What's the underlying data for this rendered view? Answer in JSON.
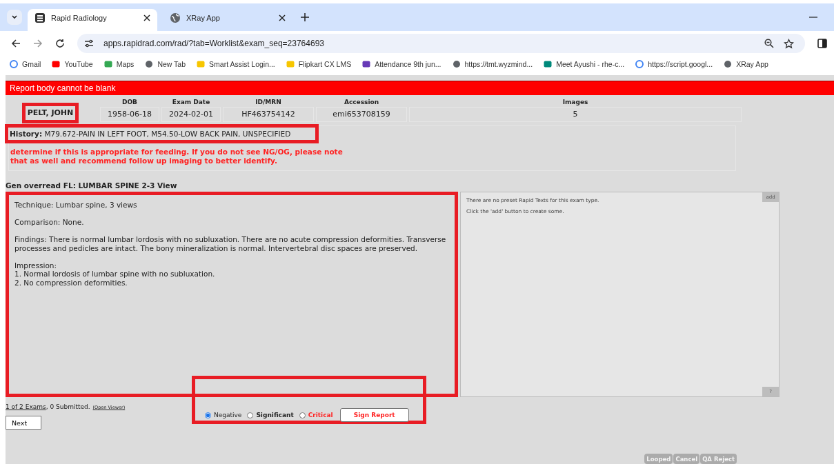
{
  "browser": {
    "tabs": [
      {
        "title": "Rapid Radiology",
        "selected": true
      },
      {
        "title": "XRay App",
        "selected": false
      }
    ],
    "url": "apps.rapidrad.com/rad/?tab=Worklist&exam_seq=23764693",
    "bookmarks": [
      "Gmail",
      "YouTube",
      "Maps",
      "New Tab",
      "Smart Assist Login...",
      "Flipkart CX LMS",
      "Attendance 9th jun...",
      "https://tmt.wyzmind...",
      "Meet Ayushi - rhe-c...",
      "https://script.googl...",
      "XRay App"
    ]
  },
  "error": "Report body cannot be blank",
  "patient": {
    "columns": [
      {
        "value": "PELT, JOHN",
        "highlight": true
      },
      {
        "label": "DOB",
        "value": "1958-06-18",
        "highlight": false
      },
      {
        "label": "Exam Date",
        "value": "2024-02-01",
        "highlight": false
      },
      {
        "label": "ID/MRN",
        "value": "HF463754142",
        "highlight": false
      },
      {
        "label": "Accession",
        "value": "emi653708159",
        "highlight": false
      },
      {
        "label": "Images",
        "value": "5",
        "highlight": false
      }
    ]
  },
  "history": {
    "label": "History:",
    "text": "M79.672-PAIN IN LEFT FOOT, M54.50-LOW BACK PAIN, UNSPECIFIED",
    "highlight": true
  },
  "qa_note": "determine if this is appropriate for feeding. If you do not see NG/OG, please note that as well and recommend follow up imaging to better identify.",
  "exam_title": "Gen overread FL: LUMBAR SPINE 2-3 View",
  "report": {
    "value": "Technique: Lumbar spine, 3 views\n\nComparison: None.\n\nFindings: There is normal lumbar lordosis with no subluxation. There are no acute compression deformities. Transverse processes and pedicles are intact. The bony mineralization is normal. Intervertebral disc spaces are preserved.\n\nImpression:\n1. Normal lordosis of lumbar spine with no subluxation.\n2. No compression deformities.",
    "highlight": true
  },
  "rapid_texts": {
    "add_button": "add",
    "lines": [
      "There are no preset Rapid Texts for this exam type.",
      "Click the 'add' button to create some."
    ],
    "help_button": "?"
  },
  "exam_counter": {
    "link": "1 of 2 Exams",
    "text": ", 0 Submitted.",
    "viewer_link": "(Open Viewer)"
  },
  "next_button": "Next",
  "flags": {
    "highlight": true,
    "options": [
      {
        "label": "Negative",
        "kind": "negative",
        "selected": true
      },
      {
        "label": "Significant",
        "kind": "significant",
        "selected": false
      },
      {
        "label": "Critical",
        "kind": "critical",
        "selected": false
      }
    ],
    "sign_button": "Sign Report"
  },
  "footer_buttons": [
    "Looped",
    "Cancel",
    "QA Reject"
  ]
}
